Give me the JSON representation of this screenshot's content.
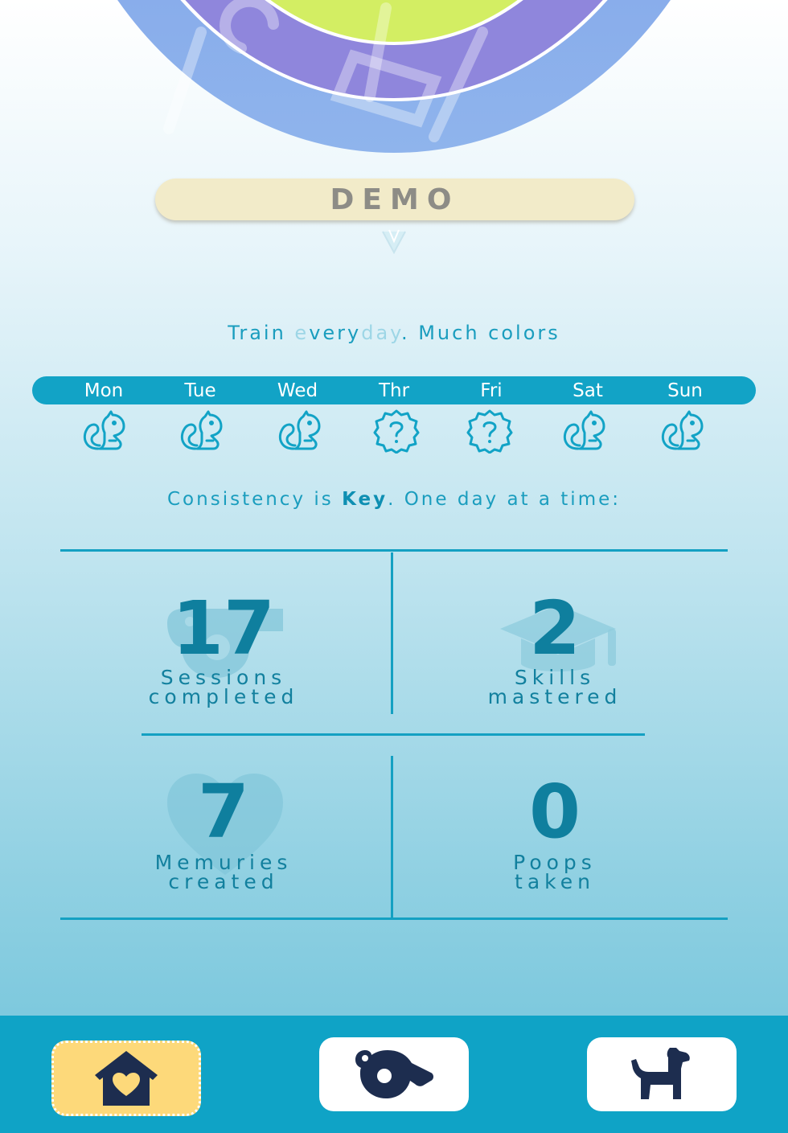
{
  "header": {
    "dog_name": "DEMO"
  },
  "tagline": {
    "part1": "Train ",
    "faint1": "e",
    "part2": "very",
    "faint2": "day",
    "part3": ". Much colors"
  },
  "week": {
    "days": [
      {
        "label": "Mon",
        "status": "squirrel-icon"
      },
      {
        "label": "Tue",
        "status": "squirrel-icon"
      },
      {
        "label": "Wed",
        "status": "squirrel-icon"
      },
      {
        "label": "Thr",
        "status": "question-badge-icon"
      },
      {
        "label": "Fri",
        "status": "question-badge-icon"
      },
      {
        "label": "Sat",
        "status": "squirrel-icon"
      },
      {
        "label": "Sun",
        "status": "squirrel-icon"
      }
    ]
  },
  "consistency": {
    "before": "Consistency is ",
    "key": "Key",
    "after": ". One day at a time:"
  },
  "stats": {
    "sessions": {
      "value": "17",
      "label1": "Sessions",
      "label2": "completed",
      "icon": "whistle-icon"
    },
    "skills": {
      "value": "2",
      "label1": "Skills",
      "label2": "mastered",
      "icon": "graduation-cap-icon"
    },
    "memuries": {
      "value": "7",
      "label1": "Memuries",
      "label2": "created",
      "icon": "heart-icon"
    },
    "poops": {
      "value": "0",
      "label1": "Poops",
      "label2": "taken",
      "icon": "poop-icon"
    }
  },
  "nav": {
    "items": [
      {
        "name": "home",
        "icon": "house-heart-icon",
        "active": true
      },
      {
        "name": "training",
        "icon": "whistle-icon",
        "active": false
      },
      {
        "name": "dog",
        "icon": "dog-icon",
        "active": false
      }
    ]
  },
  "colors": {
    "accent": "#12a3c6",
    "stat_text": "#0f7f9e",
    "nav_active": "#fdd97a",
    "icon_dark": "#1d2d4f"
  }
}
